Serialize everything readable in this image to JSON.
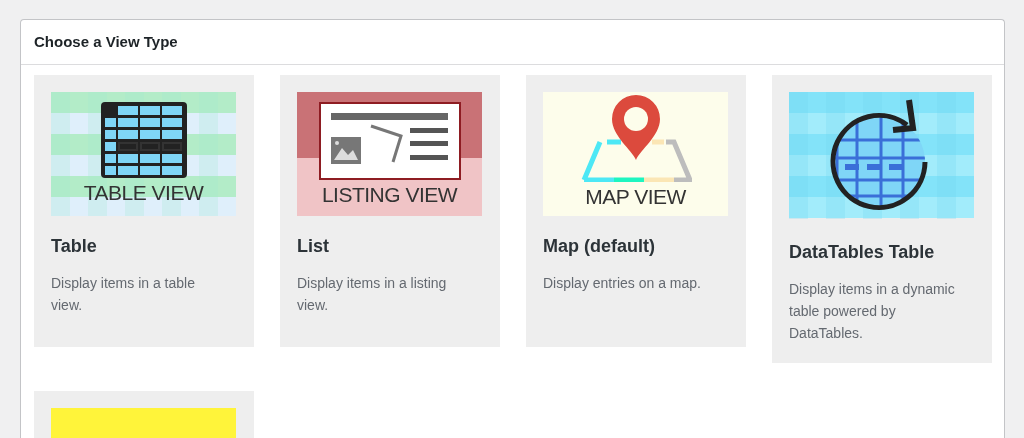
{
  "panel": {
    "title": "Choose a View Type"
  },
  "views": [
    {
      "kind": "table",
      "caption": "TABLE VIEW",
      "title": "Table",
      "description": "Display items in a table view."
    },
    {
      "kind": "listing",
      "caption": "LISTING VIEW",
      "title": "List",
      "description": "Display items in a listing view."
    },
    {
      "kind": "map",
      "caption": "MAP VIEW",
      "title": "Map (default)",
      "description": "Display entries on a map."
    },
    {
      "kind": "datatables",
      "title": "DataTables Table",
      "description": "Display items in a dynamic table powered by DataTables."
    },
    {
      "kind": "diy"
    }
  ]
}
